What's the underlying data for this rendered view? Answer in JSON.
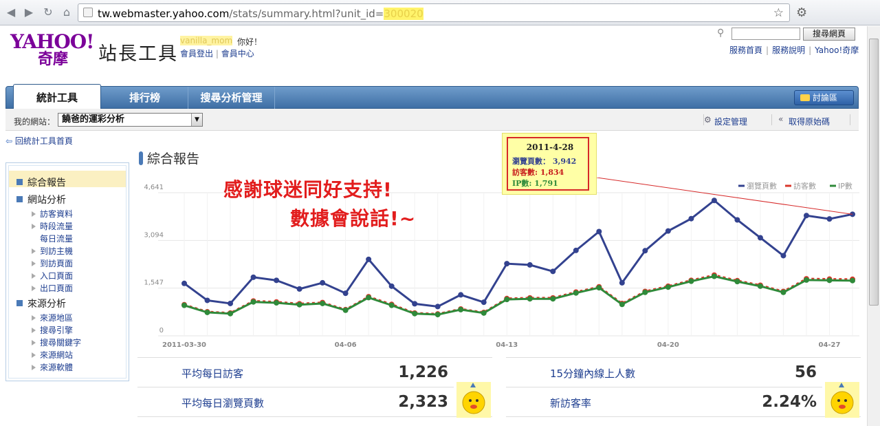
{
  "browser": {
    "url_host": "tw.webmaster.yahoo.com",
    "url_path": "/stats/summary.html?unit_id=",
    "url_redacted": "300020"
  },
  "header": {
    "brand": "YAHOO!",
    "brand_sub": "奇摩",
    "site_title": "站長工具",
    "greeting_user": "vanilla_mom",
    "greeting_tail": "你好！",
    "logout": "會員登出",
    "member_center": "會員中心",
    "search_button": "搜尋網頁",
    "links": [
      "服務首頁",
      "服務說明",
      "Yahoo!奇摩"
    ]
  },
  "tabs": [
    "統計工具",
    "排行榜",
    "搜尋分析管理"
  ],
  "forum_button": "討論區",
  "sitebar": {
    "label": "我的網站：",
    "selected": "饒爸的運彩分析",
    "settings": "設定管理",
    "raw_code": "取得原始碼"
  },
  "back_link": "回統計工具首頁",
  "sidebar": {
    "sections": [
      {
        "label": "綜合報告",
        "items": []
      },
      {
        "label": "網站分析",
        "items": [
          "訪客資料",
          "時段流量",
          "每日流量",
          "到訪主機",
          "到訪頁面",
          "入口頁面",
          "出口頁面"
        ]
      },
      {
        "label": "來源分析",
        "items": [
          "來源地區",
          "搜尋引擎",
          "搜尋關鍵字",
          "來源網站",
          "來源軟體"
        ]
      }
    ]
  },
  "main": {
    "title": "綜合報告",
    "overlay_line1": "感謝球迷同好支持!",
    "overlay_line2": "數據會說話!~"
  },
  "tooltip": {
    "date": "2011-4-28",
    "pageviews": "瀏覽頁數： 3,942",
    "visitors": "訪客數: 1,834",
    "ips": "IP數: 1,791"
  },
  "stats": {
    "avg_daily_visitors_label": "平均每日訪客",
    "avg_daily_visitors": "1,226",
    "avg_daily_pageviews_label": "平均每日瀏覽頁數",
    "avg_daily_pageviews": "2,323",
    "online_15min_label": "15分鐘內線上人數",
    "online_15min": "56",
    "new_visitor_rate_label": "新訪客率",
    "new_visitor_rate": "2.24%"
  },
  "colors": {
    "pageviews": "#33428f",
    "visitors": "#d9372b",
    "ips": "#2f8a3a"
  },
  "chart_data": {
    "type": "line",
    "title": "",
    "xlabel": "",
    "ylabel": "",
    "ylim": [
      0,
      4641
    ],
    "yticks": [
      "0",
      "1,547",
      "3,094",
      "4,641"
    ],
    "xtick_labels": [
      "2011-03-30",
      "04-06",
      "04-13",
      "04-20",
      "04-27"
    ],
    "x": [
      "2011-03-30",
      "2011-03-31",
      "2011-04-01",
      "2011-04-02",
      "2011-04-03",
      "2011-04-04",
      "2011-04-05",
      "2011-04-06",
      "2011-04-07",
      "2011-04-08",
      "2011-04-09",
      "2011-04-10",
      "2011-04-11",
      "2011-04-12",
      "2011-04-13",
      "2011-04-14",
      "2011-04-15",
      "2011-04-16",
      "2011-04-17",
      "2011-04-18",
      "2011-04-19",
      "2011-04-20",
      "2011-04-21",
      "2011-04-22",
      "2011-04-23",
      "2011-04-24",
      "2011-04-25",
      "2011-04-26",
      "2011-04-27",
      "2011-04-28"
    ],
    "legend": [
      "瀏覽頁數",
      "訪客數",
      "IP數"
    ],
    "legend_position": "top-right",
    "series": [
      {
        "name": "瀏覽頁數",
        "values": [
          1700,
          1150,
          1050,
          1900,
          1800,
          1520,
          1720,
          1380,
          2480,
          1610,
          1040,
          950,
          1330,
          1090,
          2340,
          2300,
          2090,
          2770,
          3380,
          1720,
          2760,
          3400,
          3800,
          4390,
          3760,
          3180,
          2600,
          3900,
          3790,
          3942
        ]
      },
      {
        "name": "訪客數",
        "values": [
          1010,
          780,
          740,
          1130,
          1100,
          1040,
          1080,
          850,
          1270,
          1020,
          740,
          710,
          870,
          760,
          1210,
          1230,
          1230,
          1420,
          1590,
          1050,
          1440,
          1610,
          1800,
          1970,
          1790,
          1640,
          1440,
          1850,
          1840,
          1834
        ]
      },
      {
        "name": "IP數",
        "values": [
          990,
          760,
          720,
          1100,
          1070,
          1010,
          1050,
          830,
          1240,
          990,
          720,
          690,
          850,
          740,
          1180,
          1200,
          1200,
          1390,
          1560,
          1020,
          1410,
          1580,
          1770,
          1930,
          1760,
          1610,
          1410,
          1810,
          1800,
          1791
        ]
      }
    ]
  }
}
